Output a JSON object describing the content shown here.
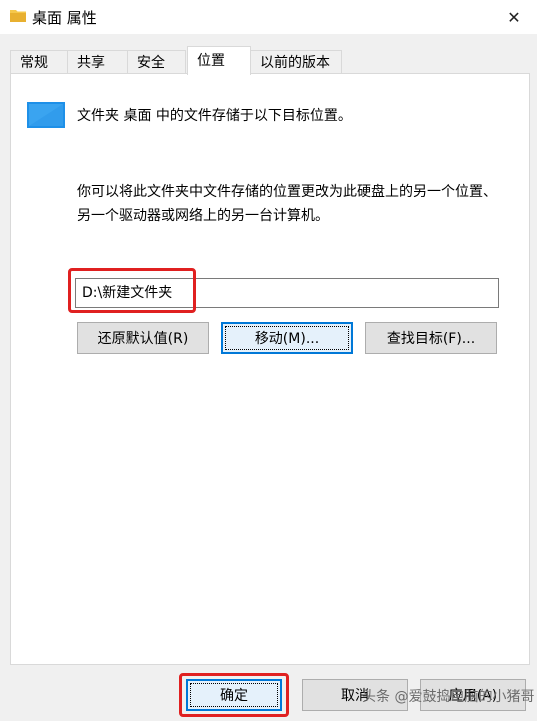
{
  "window": {
    "title": "桌面 属性",
    "close_symbol": "✕"
  },
  "tabs": [
    {
      "label": "常规",
      "active": false
    },
    {
      "label": "共享",
      "active": false
    },
    {
      "label": "安全",
      "active": false
    },
    {
      "label": "位置",
      "active": true
    },
    {
      "label": "以前的版本",
      "active": false
    }
  ],
  "location": {
    "description": "文件夹 桌面 中的文件存储于以下目标位置。",
    "instructions": "你可以将此文件夹中文件存储的位置更改为此硬盘上的另一个位置、另一个驱动器或网络上的另一台计算机。",
    "path_value": "D:\\新建文件夹",
    "restore_default_label": "还原默认值(R)",
    "move_label": "移动(M)...",
    "find_target_label": "查找目标(F)..."
  },
  "footer": {
    "ok_label": "确定",
    "cancel_label": "取消",
    "apply_label": "应用(A)"
  },
  "watermark": "头条 @爱鼓捣电脑的小猪哥",
  "icons": {
    "title": "folder-icon",
    "location": "desktop-folder-icon",
    "close": "close-icon"
  },
  "colors": {
    "highlight": "#e02020",
    "focus": "#0078d7",
    "folder_blue": "#1e90e8",
    "folder_yellow": "#f5c84c"
  }
}
